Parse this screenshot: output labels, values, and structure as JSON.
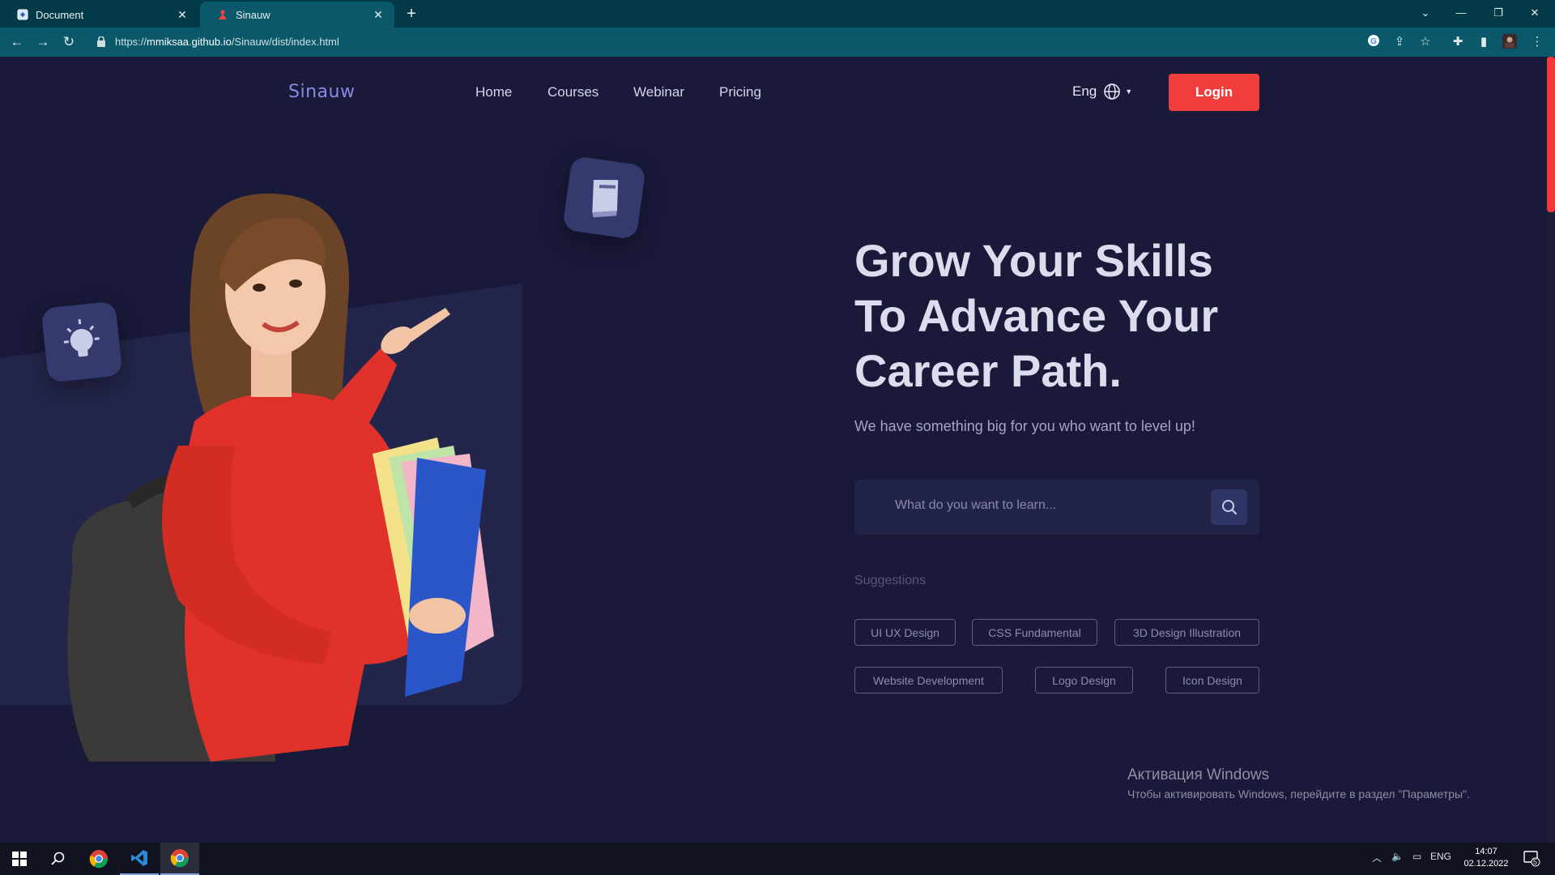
{
  "browser": {
    "tabs": [
      {
        "title": "Document",
        "active": false,
        "icon": "document-favicon-icon"
      },
      {
        "title": "Sinauw",
        "active": true,
        "icon": "sinauw-favicon-icon"
      }
    ],
    "url_prefix": "https://",
    "url_host": "mmiksaa.github.io",
    "url_path": "/Sinauw/dist/index.html",
    "accent": "#0a5869"
  },
  "nav": {
    "logo": "Sinauw",
    "links": [
      "Home",
      "Courses",
      "Webinar",
      "Pricing"
    ],
    "language": "Eng",
    "login_label": "Login"
  },
  "hero": {
    "headline_line1": "Grow Your Skills",
    "headline_line2": "To Advance Your",
    "headline_line3": "Career Path.",
    "subline": "We have something big for you who want to level up!",
    "search_placeholder": "What do you want to learn...",
    "suggestions_label": "Suggestions",
    "chips": [
      "UI UX Design",
      "CSS Fundamental",
      "3D Design Illustration",
      "Website Development",
      "Logo Design",
      "Icon Design"
    ]
  },
  "overlay": {
    "activation_title": "Активация Windows",
    "activation_sub": "Чтобы активировать Windows, перейдите в раздел \"Параметры\"."
  },
  "taskbar": {
    "language": "ENG",
    "time": "14:07",
    "date": "02.12.2022",
    "notifications": "5"
  },
  "colors": {
    "background": "#19193a",
    "login": "#f23d3d",
    "logo": "#8a8ae6",
    "panel": "#23254a"
  }
}
